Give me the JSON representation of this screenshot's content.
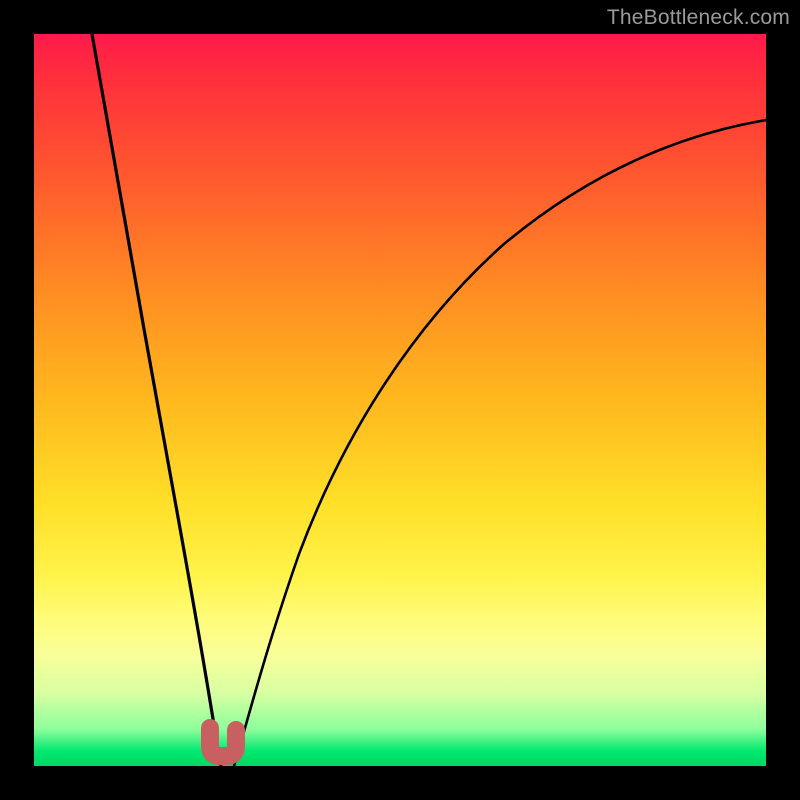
{
  "watermark": "TheBottleneck.com",
  "colors": {
    "background": "#000000",
    "gradient_top": "#ff1a4b",
    "gradient_bottom": "#00d766",
    "curve": "#000000",
    "u_mark": "#c86061"
  },
  "chart_data": {
    "type": "line",
    "title": "",
    "xlabel": "",
    "ylabel": "",
    "xlim": [
      0,
      100
    ],
    "ylim": [
      0,
      100
    ],
    "note": "No axes, ticks, or numeric labels are rendered in the image; values below are normalized 0–100 estimates read from pixel positions (y=0 at bottom, x=0 at left).",
    "series": [
      {
        "name": "left-curve",
        "x": [
          8,
          10,
          12,
          14,
          16,
          18,
          20,
          22,
          23.5,
          25
        ],
        "y": [
          100,
          88,
          75,
          62,
          49,
          36,
          23,
          11,
          4,
          0
        ]
      },
      {
        "name": "right-curve",
        "x": [
          27,
          29,
          32,
          36,
          41,
          47,
          54,
          62,
          71,
          81,
          91,
          100
        ],
        "y": [
          0,
          8,
          18,
          30,
          42,
          53,
          62,
          70,
          76,
          81,
          85,
          88
        ]
      }
    ],
    "annotations": [
      {
        "name": "u-mark",
        "shape": "small-u",
        "approx_x": 25.5,
        "approx_y": 2,
        "color": "#c86061"
      }
    ]
  }
}
